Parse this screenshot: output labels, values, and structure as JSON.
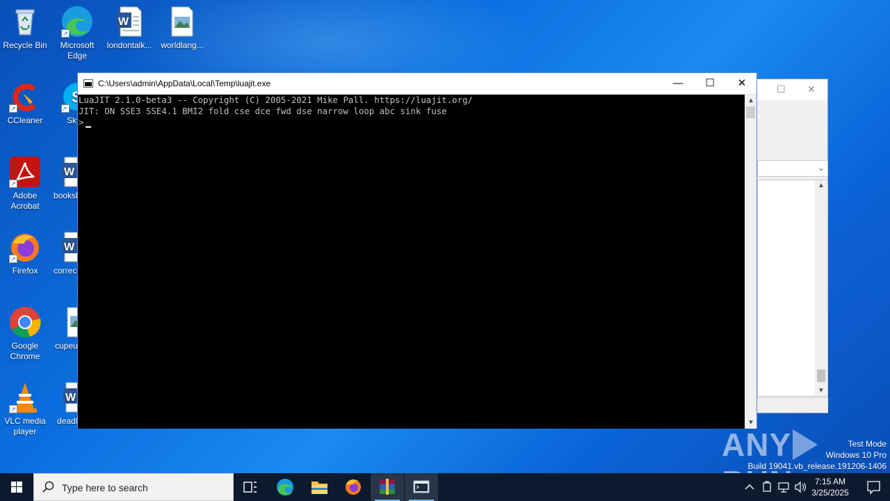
{
  "desktop": {
    "icons": [
      {
        "label": "Recycle Bin"
      },
      {
        "label": "Microsoft Edge"
      },
      {
        "label": "londontalk..."
      },
      {
        "label": "worldlang..."
      },
      {
        "label": "CCleaner"
      },
      {
        "label": "Sky"
      },
      {
        "label": "Adobe Acrobat"
      },
      {
        "label": "booksh"
      },
      {
        "label": "Firefox"
      },
      {
        "label": "correc"
      },
      {
        "label": "Google Chrome"
      },
      {
        "label": "cupeu"
      },
      {
        "label": "VLC media player"
      },
      {
        "label": "deadl"
      }
    ]
  },
  "console": {
    "title": "C:\\Users\\admin\\AppData\\Local\\Temp\\luajit.exe",
    "lines": [
      "LuaJIT 2.1.0-beta3 -- Copyright (C) 2005-2021 Mike Pall. https://luajit.org/",
      "JIT: ON SSE3 SSE4.1 BMI2 fold cse dce fwd dse narrow loop abc sink fuse",
      ">"
    ],
    "minimize_glyph": "—",
    "maximize_glyph": "☐",
    "close_glyph": "✕"
  },
  "watermark": {
    "brand_left": "ANY",
    "brand_right": "RUN",
    "test_mode": "Test Mode",
    "os": "Windows 10 Pro",
    "build": "Build 19041.vb_release.191206-1406"
  },
  "taskbar": {
    "search_placeholder": "Type here to search",
    "clock_time": "7:15 AM",
    "clock_date": "3/25/2025"
  },
  "colors": {
    "taskbar_bg": "#0d1a2e",
    "accent": "#76b9ed",
    "console_text": "#c0c0c0"
  }
}
